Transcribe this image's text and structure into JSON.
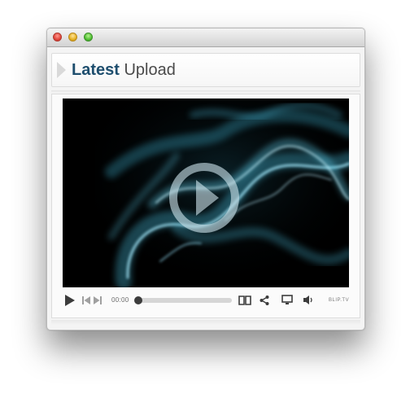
{
  "window": {
    "traffic_lights": [
      "close",
      "minimize",
      "zoom"
    ]
  },
  "header": {
    "title_strong": "Latest",
    "title_rest": "Upload",
    "icon": "chevron-right-icon"
  },
  "player": {
    "big_play_icon": "play-circle-icon",
    "time": "00:00",
    "progress": 0,
    "brand": "BLIP.TV",
    "controls": [
      "play-icon",
      "previous-icon",
      "next-icon",
      "book-icon",
      "share-icon",
      "screen-icon",
      "volume-icon"
    ]
  },
  "colors": {
    "title_strong": "#1e4e6e",
    "title_rest": "#4a4a4a",
    "smoke": "#5ec8e6",
    "control_icon": "#3c3c3c"
  }
}
